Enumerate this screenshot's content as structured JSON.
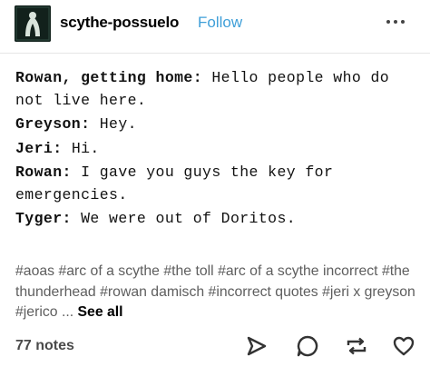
{
  "post": {
    "username": "scythe-possuelo",
    "follow_label": "Follow",
    "lines": [
      {
        "speaker": "Rowan, getting home:",
        "text": " Hello people who do not live here."
      },
      {
        "speaker": "Greyson:",
        "text": " Hey."
      },
      {
        "speaker": "Jeri:",
        "text": " Hi."
      },
      {
        "speaker": "Rowan:",
        "text": " I gave you guys the key for emergencies."
      },
      {
        "speaker": "Tyger:",
        "text": " We were out of Doritos."
      }
    ],
    "tags": [
      "#aoas",
      "#arc of a scythe",
      "#the toll",
      "#arc of a scythe incorrect",
      "#the thunderhead",
      "#rowan damisch",
      "#incorrect quotes",
      "#jeri x greyson",
      "#jerico"
    ],
    "tags_ellipsis": "...",
    "see_all_label": "See all",
    "notes_label": "77 notes"
  },
  "icons": {
    "more": "more-options-icon",
    "share": "share-icon",
    "reply": "reply-icon",
    "reblog": "reblog-icon",
    "like": "heart-icon"
  },
  "colors": {
    "follow": "#3f9fd8",
    "tag": "#5e5e5e",
    "icon": "#333333"
  }
}
